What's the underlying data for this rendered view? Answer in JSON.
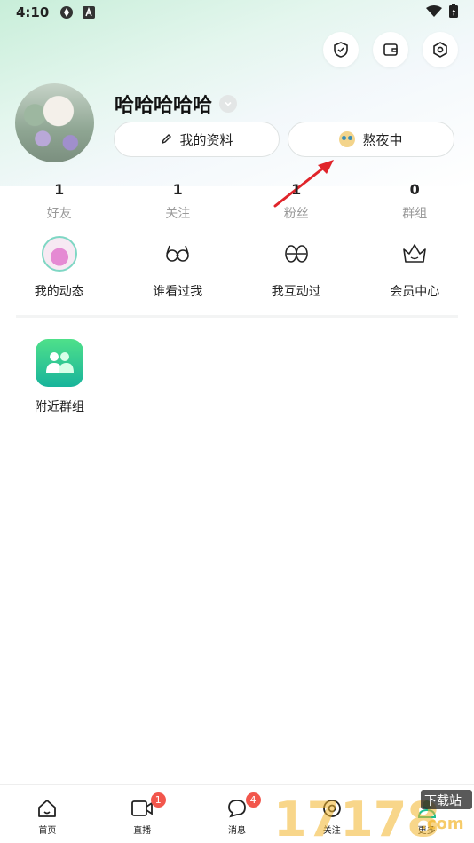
{
  "status_bar": {
    "time": "4:10"
  },
  "profile": {
    "username": "哈哈哈哈哈",
    "edit_profile_label": "我的资料",
    "status_label": "熬夜中"
  },
  "stats": [
    {
      "num": "1",
      "label": "好友"
    },
    {
      "num": "1",
      "label": "关注"
    },
    {
      "num": "1",
      "label": "粉丝"
    },
    {
      "num": "0",
      "label": "群组"
    }
  ],
  "quick_actions": [
    {
      "label": "我的动态",
      "icon": "dynamic-avatar-icon"
    },
    {
      "label": "谁看过我",
      "icon": "glasses-icon"
    },
    {
      "label": "我互动过",
      "icon": "footprints-icon"
    },
    {
      "label": "会员中心",
      "icon": "crown-icon"
    }
  ],
  "features": [
    {
      "label": "附近群组",
      "icon": "group-icon"
    }
  ],
  "tabbar": [
    {
      "label": "首页",
      "icon": "home-icon",
      "badge": ""
    },
    {
      "label": "直播",
      "icon": "video-icon",
      "badge": "1"
    },
    {
      "label": "消息",
      "icon": "message-icon",
      "badge": "4"
    },
    {
      "label": "关注",
      "icon": "eye-icon",
      "badge": ""
    },
    {
      "label": "更多",
      "icon": "person-icon",
      "badge": ""
    }
  ],
  "watermark": {
    "text": "17178",
    "subtext": "下载站",
    "suffix": ".com"
  },
  "colors": {
    "accent": "#1fbf8f",
    "badge": "#f2564c",
    "arrow": "#e0242a"
  }
}
